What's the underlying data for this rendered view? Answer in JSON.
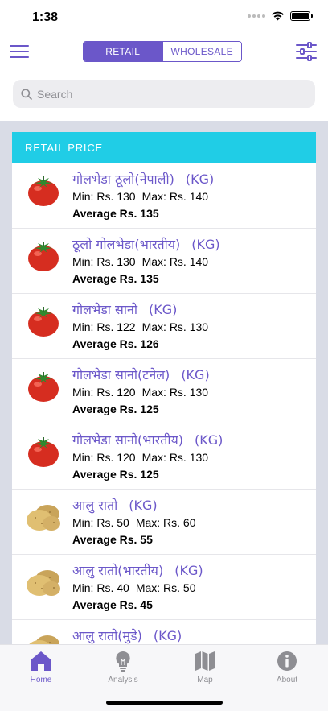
{
  "status": {
    "time": "1:38"
  },
  "header": {
    "segments": [
      {
        "label": "RETAIL",
        "active": true
      },
      {
        "label": "WHOLESALE",
        "active": false
      }
    ],
    "accent_color": "#6b57c9"
  },
  "search": {
    "placeholder": "Search",
    "value": ""
  },
  "card": {
    "title": "RETAIL PRICE",
    "header_color": "#20cde6"
  },
  "items": [
    {
      "icon": "tomato-icon",
      "name": "गोलभेडा ठूलो(नेपाली)",
      "unit": "(KG)",
      "min": "Min: Rs. 130",
      "max": "Max: Rs. 140",
      "avg": "Average Rs. 135"
    },
    {
      "icon": "tomato-icon",
      "name": "ठूलो गोलभेडा(भारतीय)",
      "unit": "(KG)",
      "min": "Min: Rs. 130",
      "max": "Max: Rs. 140",
      "avg": "Average Rs. 135"
    },
    {
      "icon": "tomato-icon",
      "name": "गोलभेडा सानो",
      "unit": "(KG)",
      "min": "Min: Rs. 122",
      "max": "Max: Rs. 130",
      "avg": "Average Rs. 126"
    },
    {
      "icon": "tomato-icon",
      "name": "गोलभेडा सानो(टनेल)",
      "unit": "(KG)",
      "min": "Min: Rs. 120",
      "max": "Max: Rs. 130",
      "avg": "Average Rs. 125"
    },
    {
      "icon": "tomato-icon",
      "name": "गोलभेडा सानो(भारतीय)",
      "unit": "(KG)",
      "min": "Min: Rs. 120",
      "max": "Max: Rs. 130",
      "avg": "Average Rs. 125"
    },
    {
      "icon": "potato-icon",
      "name": "आलु रातो",
      "unit": "(KG)",
      "min": "Min: Rs. 50",
      "max": "Max: Rs. 60",
      "avg": "Average Rs. 55"
    },
    {
      "icon": "potato-icon",
      "name": "आलु रातो(भारतीय)",
      "unit": "(KG)",
      "min": "Min: Rs. 40",
      "max": "Max: Rs. 50",
      "avg": "Average Rs. 45"
    },
    {
      "icon": "potato-icon",
      "name": "आलु रातो(मुडे)",
      "unit": "(KG)",
      "min": "",
      "max": "",
      "avg": ""
    }
  ],
  "tabs": [
    {
      "label": "Home",
      "icon": "home-icon",
      "active": true
    },
    {
      "label": "Analysis",
      "icon": "lightbulb-icon",
      "active": false
    },
    {
      "label": "Map",
      "icon": "map-icon",
      "active": false
    },
    {
      "label": "About",
      "icon": "info-icon",
      "active": false
    }
  ]
}
